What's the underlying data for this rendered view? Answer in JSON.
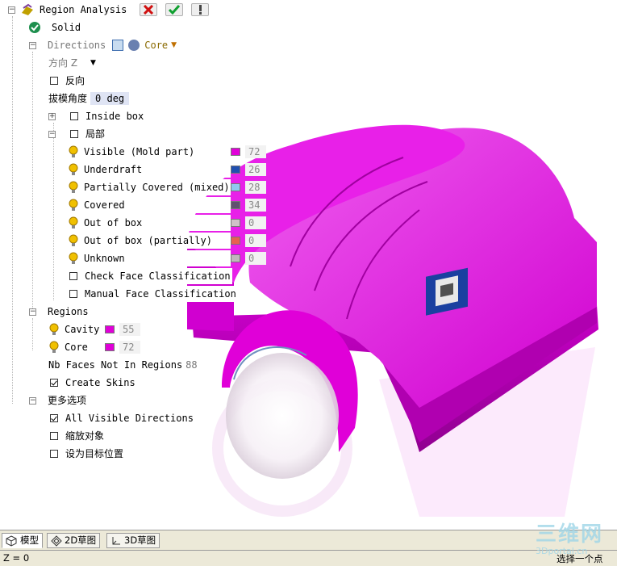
{
  "tree": {
    "title": "Region Analysis",
    "title_buttons": [
      "cancel",
      "ok",
      "info"
    ],
    "solid": "Solid",
    "directions": "Directions",
    "direction_core": "Core",
    "dir_label": "方向 Z",
    "reverse": "反向",
    "draft_angle_label": "拔模角度",
    "draft_angle_value": "0 deg",
    "inside_box": "Inside box",
    "local": "局部",
    "categories": [
      {
        "label": "Visible (Mold part)",
        "color": "#e000d8",
        "count": "72"
      },
      {
        "label": "Underdraft",
        "color": "#2050b0",
        "count": "26"
      },
      {
        "label": "Partially Covered (mixed)",
        "color": "#90c8f0",
        "count": "28"
      },
      {
        "label": "Covered",
        "color": "#605070",
        "count": "34"
      },
      {
        "label": "Out of box",
        "color": "#d0c0c8",
        "count": "0"
      },
      {
        "label": "Out of box (partially)",
        "color": "#e86050",
        "count": "0"
      },
      {
        "label": "Unknown",
        "color": "#c0b8bc",
        "count": "0"
      }
    ],
    "check_face": "Check Face Classification",
    "manual_face": "Manual Face Classification",
    "regions": "Regions",
    "region_items": [
      {
        "label": "Cavity",
        "color": "#e000d8",
        "count": "55"
      },
      {
        "label": "Core",
        "color": "#e000d8",
        "count": "72"
      }
    ],
    "nb_faces": "Nb Faces Not In Regions",
    "nb_faces_value": "88",
    "create_skins": "Create Skins",
    "more_options": "更多选项",
    "all_visible": "All Visible Directions",
    "scale": "缩放对象",
    "set_target": "设为目标位置"
  },
  "tabs": [
    "模型",
    "2D草图",
    "3D草图"
  ],
  "status": {
    "left": "Z = 0",
    "right": "选择一个点"
  },
  "watermark": {
    "line1": "三维网",
    "line2": "3Dportal.cn"
  },
  "colors": {
    "model": "#e000d8",
    "model_dark": "#8a0088",
    "model_light": "#f070f0"
  }
}
